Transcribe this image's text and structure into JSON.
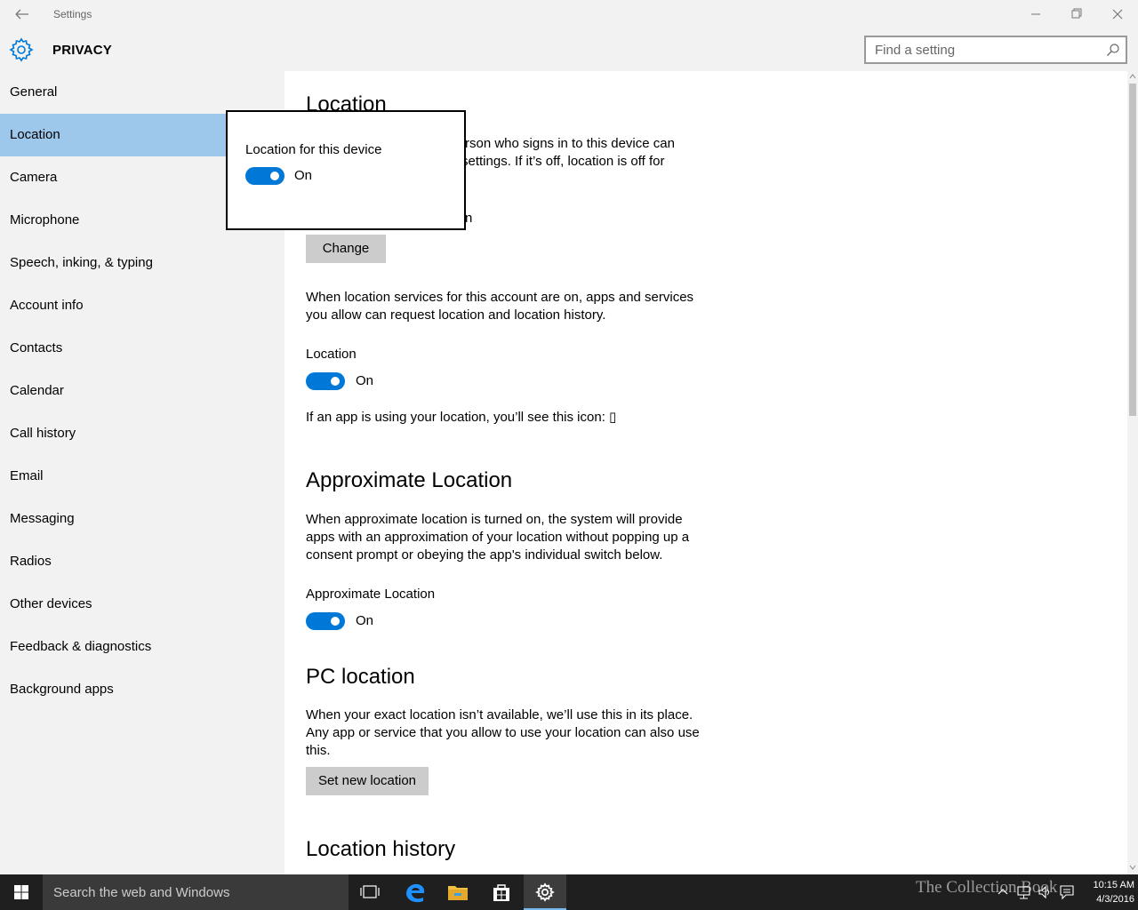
{
  "window": {
    "title": "Settings",
    "app_title": "PRIVACY"
  },
  "search": {
    "placeholder": "Find a setting"
  },
  "sidebar": {
    "items": [
      {
        "label": "General"
      },
      {
        "label": "Location"
      },
      {
        "label": "Camera"
      },
      {
        "label": "Microphone"
      },
      {
        "label": "Speech, inking, & typing"
      },
      {
        "label": "Account info"
      },
      {
        "label": "Contacts"
      },
      {
        "label": "Calendar"
      },
      {
        "label": "Call history"
      },
      {
        "label": "Email"
      },
      {
        "label": "Messaging"
      },
      {
        "label": "Radios"
      },
      {
        "label": "Other devices"
      },
      {
        "label": "Feedback & diagnostics"
      },
      {
        "label": "Background apps"
      }
    ],
    "selected": "Location"
  },
  "content": {
    "location_title": "Location",
    "location_desc_line1": "rson who signs in to this device can",
    "location_desc_line2": "settings. If it’s off, location is off for",
    "device_status_tail": "n",
    "change_button": "Change",
    "account_desc": "When location services for this account are on, apps and services you allow can request location and location history.",
    "location_toggle_label": "Location",
    "location_toggle_state": "On",
    "icon_note": "If an app is using your location, you’ll see this icon: ▯",
    "approx_title": "Approximate Location",
    "approx_desc": "When approximate location is turned on, the system will provide apps with an approximation of your location without popping up a consent prompt or obeying the app's individual switch below.",
    "approx_toggle_label": "Approximate Location",
    "approx_toggle_state": "On",
    "pc_title": "PC location",
    "pc_desc": "When your exact location isn’t available, we’ll use this in its place. Any app or service that you allow to use your location can also use this.",
    "set_location_button": "Set new location",
    "history_title": "Location history"
  },
  "popup": {
    "label": "Location for this device",
    "state": "On"
  },
  "taskbar": {
    "search_text": "Search the web and Windows",
    "time": "10:15 AM",
    "date": "4/3/2016",
    "watermark": "The Collection Book"
  },
  "colors": {
    "accent": "#0078d7",
    "selected_nav": "#9ec7ec",
    "chrome": "#f2f2f2",
    "taskbar": "#1f1f1f"
  }
}
